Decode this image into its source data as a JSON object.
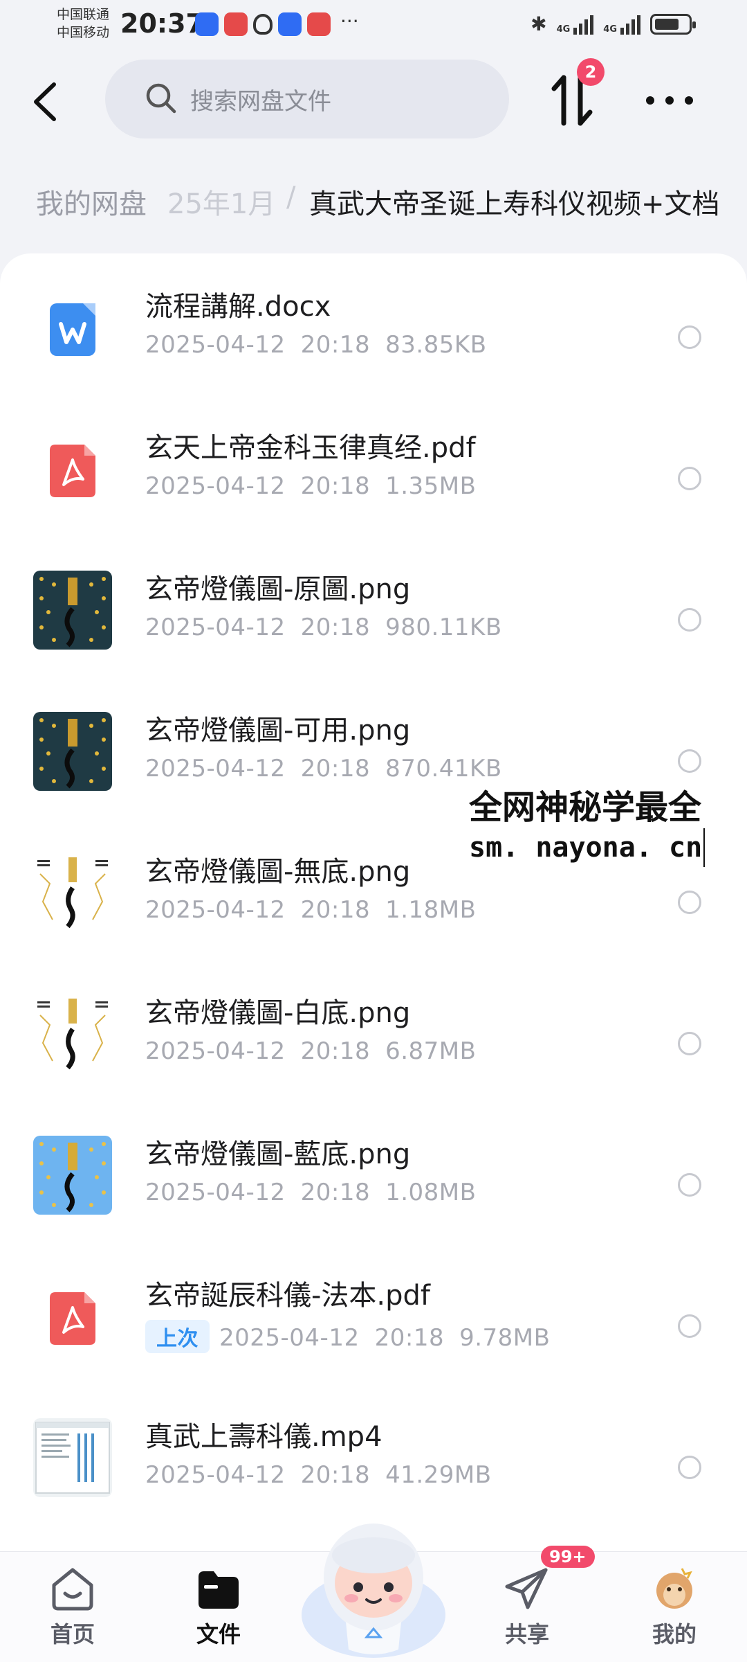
{
  "status_bar": {
    "carrier_1": "中国联通",
    "carrier_2": "中国移动",
    "time": "20:37",
    "more_indicator": "···",
    "network_1": "4G",
    "network_2": "4G"
  },
  "top_bar": {
    "search_placeholder": "搜索网盘文件",
    "transfer_badge": "2"
  },
  "breadcrumb": {
    "root": "我的网盘",
    "middle": "25年1月",
    "separator": "/",
    "current": "真武大帝圣诞上寿科仪视频+文档"
  },
  "files": [
    {
      "name": "流程講解.docx",
      "date": "2025-04-12",
      "time": "20:18",
      "size": "83.85KB",
      "icon": "word-doc-icon"
    },
    {
      "name": "玄天上帝金科玉律真经.pdf",
      "date": "2025-04-12",
      "time": "20:18",
      "size": "1.35MB",
      "icon": "pdf-icon"
    },
    {
      "name": "玄帝燈儀圖-原圖.png",
      "date": "2025-04-12",
      "time": "20:18",
      "size": "980.11KB",
      "icon": "image-thumbnail-dark"
    },
    {
      "name": "玄帝燈儀圖-可用.png",
      "date": "2025-04-12",
      "time": "20:18",
      "size": "870.41KB",
      "icon": "image-thumbnail-dark"
    },
    {
      "name": "玄帝燈儀圖-無底.png",
      "date": "2025-04-12",
      "time": "20:18",
      "size": "1.18MB",
      "icon": "image-thumbnail-white"
    },
    {
      "name": "玄帝燈儀圖-白底.png",
      "date": "2025-04-12",
      "time": "20:18",
      "size": "6.87MB",
      "icon": "image-thumbnail-white"
    },
    {
      "name": "玄帝燈儀圖-藍底.png",
      "date": "2025-04-12",
      "time": "20:18",
      "size": "1.08MB",
      "icon": "image-thumbnail-blue"
    },
    {
      "name": "玄帝誕辰科儀-法本.pdf",
      "tag": "上次",
      "date": "2025-04-12",
      "time": "20:18",
      "size": "9.78MB",
      "icon": "pdf-icon"
    },
    {
      "name": "真武上壽科儀.mp4",
      "date": "2025-04-12",
      "time": "20:18",
      "size": "41.29MB",
      "icon": "video-thumbnail"
    }
  ],
  "watermark": {
    "line1": "全网神秘学最全",
    "line2": "sm. nayona. cn"
  },
  "tab_bar": {
    "home": "首页",
    "files": "文件",
    "share": "共享",
    "share_badge": "99+",
    "mine": "我的"
  },
  "colors": {
    "background": "#f2f3f7",
    "accent_badge": "#f24a6b",
    "word_blue": "#3d8ef0",
    "pdf_red": "#ef5a5a",
    "tag_blue": "#2e8ff0"
  }
}
